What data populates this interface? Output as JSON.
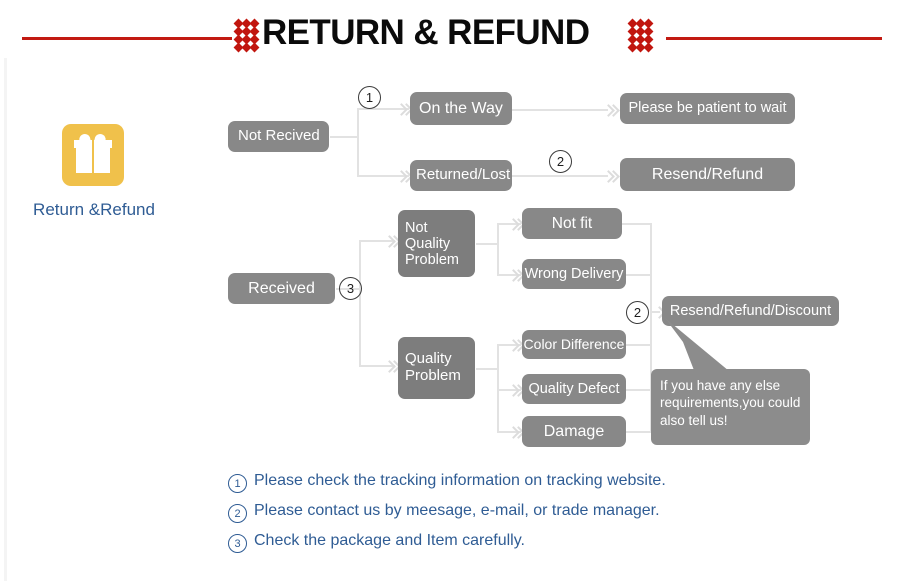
{
  "header": {
    "title": "RETURN & REFUND",
    "rule_color": "#c21a12",
    "dot_color": "#c1160f"
  },
  "left_panel": {
    "icon_name": "gift-box-icon",
    "icon_color": "#f0c14b",
    "label": "Return &Refund",
    "label_color": "#2f5c94"
  },
  "flow": {
    "node_color": "#888888",
    "node_color_dark": "#7d7d7d",
    "connector_color": "#e2e2e2",
    "nodes": {
      "not_received": "Not Recived",
      "on_the_way": "On the Way",
      "returned_lost": "Returned/Lost",
      "please_be_patient": "Please be patient to wait",
      "resend_refund": "Resend/Refund",
      "received": "Received",
      "not_quality_problem": "Not\nQuality\nProblem",
      "not_quality_problem_l1": "Not",
      "not_quality_problem_l2": "Quality",
      "not_quality_problem_l3": "Problem",
      "not_fit": "Not fit",
      "wrong_delivery": "Wrong Delivery",
      "quality_problem_l1": "Quality",
      "quality_problem_l2": "Problem",
      "color_difference": "Color Difference",
      "quality_defect": "Quality Defect",
      "damage": "Damage",
      "resend_refund_discount": "Resend/Refund/Discount"
    },
    "markers": {
      "m1": "1",
      "m2_top": "2",
      "m3": "3",
      "m2_bottom": "2"
    }
  },
  "callout": {
    "line1": "If you have any else",
    "line2": "requirements,you could",
    "line3": "also tell us!"
  },
  "notes": [
    {
      "num": "1",
      "text": "Please check the tracking information on tracking website."
    },
    {
      "num": "2",
      "text": "Please contact us by meesage, e-mail, or trade manager."
    },
    {
      "num": "3",
      "text": "Check the package and Item carefully."
    }
  ]
}
